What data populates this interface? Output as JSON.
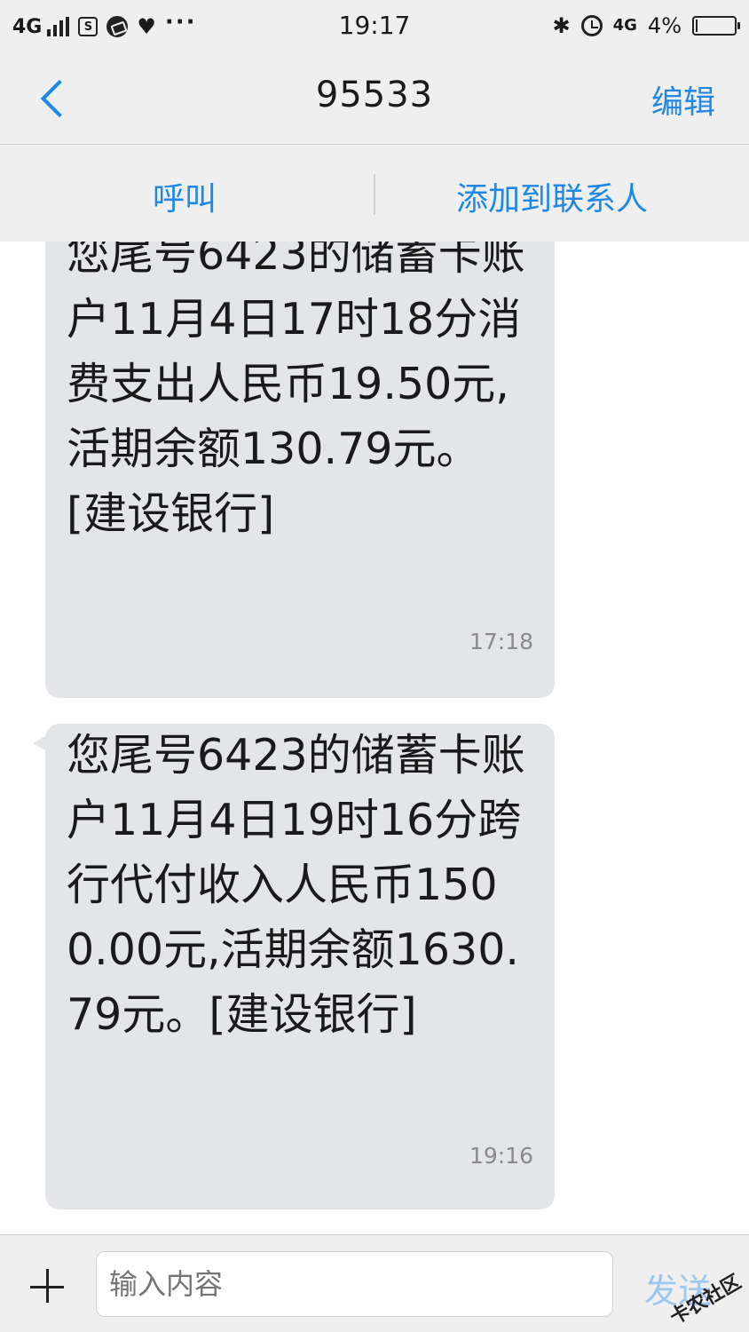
{
  "status_bar": {
    "network": "4G",
    "time": "19:17",
    "network_right": "4G",
    "battery_percent": "4%",
    "battery_level": 0.04,
    "icons": [
      "signal-icon",
      "sim-icon",
      "app-icon",
      "shield-icon",
      "more-dots-icon",
      "bluetooth-icon",
      "alarm-icon",
      "battery-icon"
    ]
  },
  "nav": {
    "title": "95533",
    "edit_label": "编辑"
  },
  "actions": {
    "call_label": "呼叫",
    "add_contact_label": "添加到联系人"
  },
  "messages": [
    {
      "text": "您尾号6423的储蓄卡账户11月4日17时18分消费支出人民币19.50元,活期余额130.79元。[建设银行]",
      "time": "17:18"
    },
    {
      "text": "您尾号6423的储蓄卡账户11月4日19时16分跨行代付收入人民币1500.00元,活期余额1630.79元。[建设银行]",
      "time": "19:16"
    }
  ],
  "composer": {
    "placeholder": "输入内容",
    "send_label": "发送",
    "watermark": "卡农社区"
  },
  "colors": {
    "accent": "#1f88e5",
    "bubble": "#e4e5e8",
    "background": "#efefef"
  }
}
